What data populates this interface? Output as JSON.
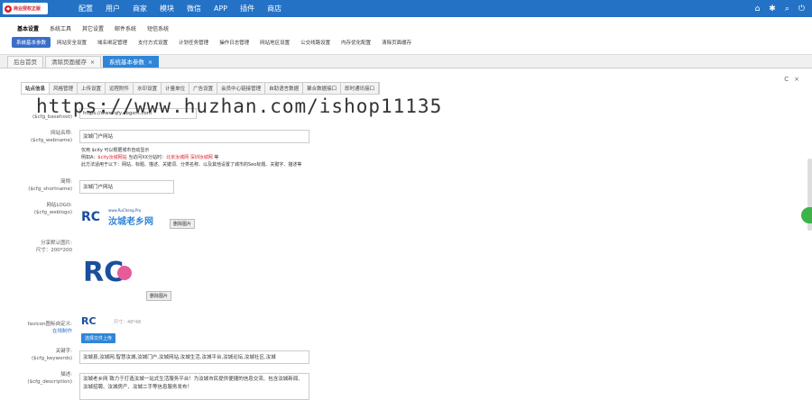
{
  "header": {
    "logo_text": "商业授权正版",
    "nav": [
      "配置",
      "用户",
      "商家",
      "模块",
      "微信",
      "APP",
      "插件",
      "商店"
    ],
    "icons": [
      "home-icon",
      "gear-icon",
      "search-icon",
      "power-icon"
    ]
  },
  "subnav": {
    "row1": [
      "基本设置",
      "系统工具",
      "其它设置",
      "邮件系统",
      "短信系统"
    ],
    "row2": [
      "系统基本参数",
      "网站安全设置",
      "域名绑定管理",
      "支付方式设置",
      "计划任务管理",
      "操作日志管理",
      "网站地区设置",
      "公交线路设置",
      "内存优化配置",
      "清除页面缓存"
    ]
  },
  "tabs": [
    {
      "label": "后台首页"
    },
    {
      "label": "清除页面缓存"
    },
    {
      "label": "系统基本参数"
    }
  ],
  "panel_tabs": [
    "站点信息",
    "风格管理",
    "上传设置",
    "远程附件",
    "水印设置",
    "计量单位",
    "广告设置",
    "会员中心链接管理",
    "自助语言数据",
    "聚合数据接口",
    "即时通讯接口"
  ],
  "watermark": "https://www.huzhan.com/ishop11135",
  "fields": {
    "basehost": {
      "label_sub": "($cfg_basehost)",
      "value": "https://www.qfy.abgsm.com"
    },
    "webname": {
      "label": "网站名称:",
      "label_sub": "($cfg_webname)",
      "value": "汝城门户网站"
    },
    "webname_note1": "仅用 $city 可以根据城市自动显示",
    "webname_note2_pre": "例如A：",
    "webname_note2_a": "$city汝城网站",
    "webname_note2_mid": " 当访问XX分站时：",
    "webname_note2_b": "北京汝城网",
    "webname_note2_c": "深圳汝城网",
    "webname_note2_end": " 等",
    "webname_note3": "此方法适用于以下：网站、标题、描述、关键词、分类名称、以及其他设置了城市的Seo标题、关键字、描述等",
    "shortname": {
      "label": "简称:",
      "label_sub": "($cfg_shortname)",
      "value": "汝城门户网站"
    },
    "weblogo": {
      "label": "网站LOGO:",
      "label_sub": "($cfg_weblogo)",
      "delete": "删除图片",
      "logo_sub": "www.RuCheng.Pro",
      "logo_main": "汝城老乡网"
    },
    "share": {
      "label": "分享默认图片:",
      "label_sub": "尺寸：200*200",
      "delete": "删除图片"
    },
    "favicon": {
      "label": "favicon图标自定义:",
      "sub_link": "在线制作",
      "size": "尺寸：48*48",
      "button": "选择文件上传"
    },
    "keywords": {
      "label": "关键字:",
      "label_sub": "($cfg_keywords)",
      "value": "汝城县,汝城网,智慧汝城,汝城门户,汝城网站,汝城生活,汝城平台,汝城论坛,汝城社区,汝城"
    },
    "description": {
      "label": "描述:",
      "label_sub": "($cfg_description)",
      "value": "汝城老乡网 致力于打造汝城一站式生活服务平台！为汝城市民提供便捷的信息交流、包含汝城新闻、汝城招聘、汝城房产、汝城二手等信息服务发布！"
    }
  },
  "colors": {
    "primary": "#2372c6",
    "tab_active": "#2f86d8",
    "accent_red": "#d6202b"
  }
}
